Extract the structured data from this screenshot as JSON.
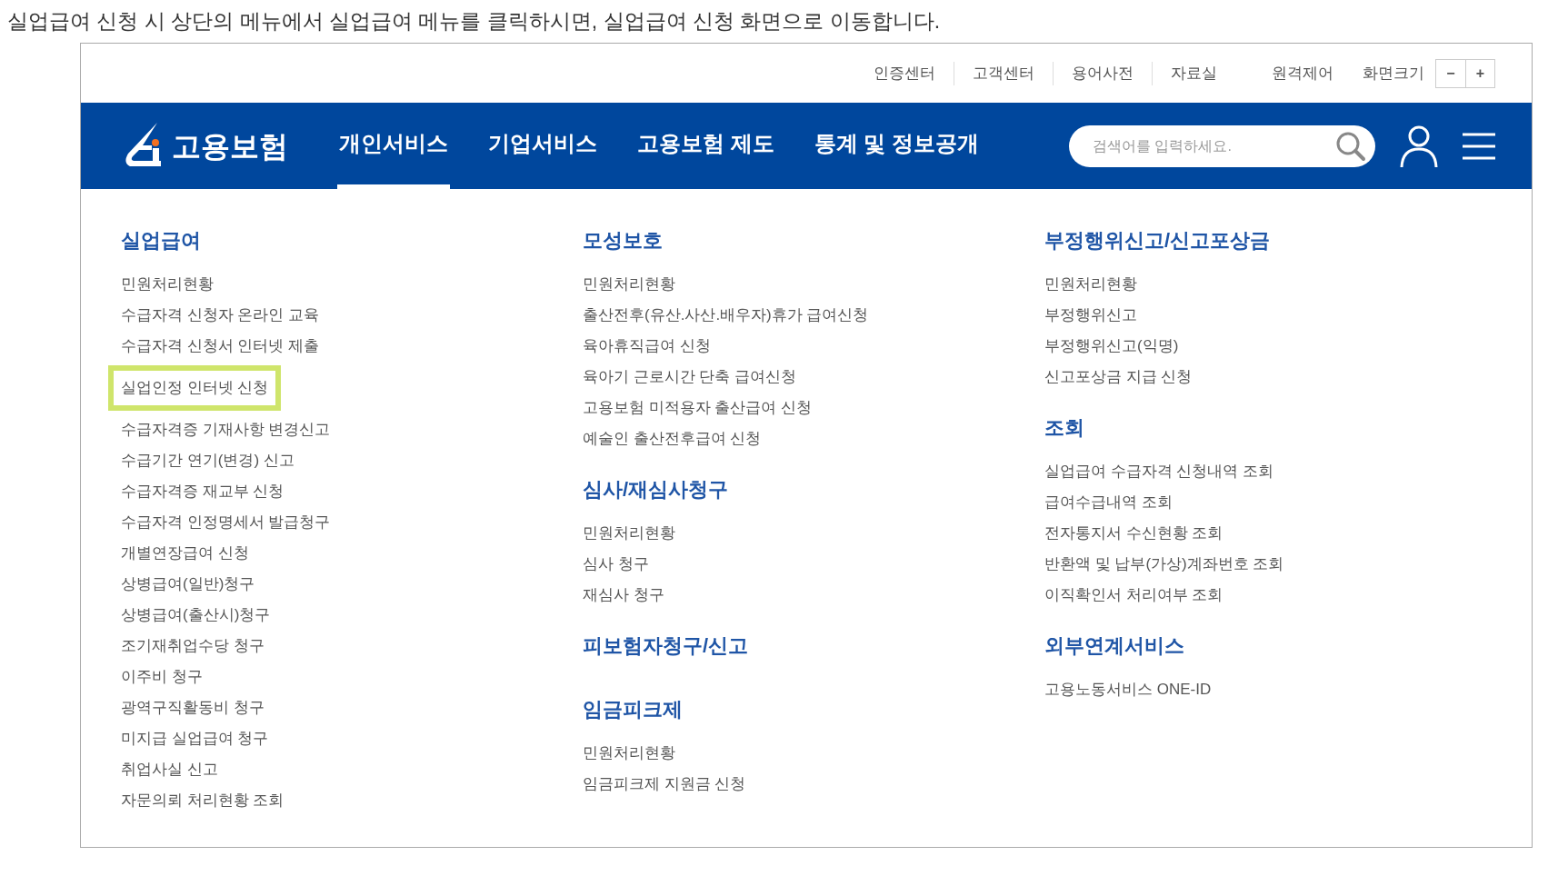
{
  "caption": "실업급여 신청 시 상단의 메뉴에서 실업급여 메뉴를 클릭하시면, 실업급여 신청 화면으로 이동합니다.",
  "utility_links": [
    "인증센터",
    "고객센터",
    "용어사전",
    "자료실",
    "원격제어"
  ],
  "font_size": {
    "label": "화면크기",
    "buttons": [
      "−",
      "+"
    ]
  },
  "logo": {
    "text": "고용보험"
  },
  "nav": [
    {
      "label": "개인서비스",
      "selected": true
    },
    {
      "label": "기업서비스",
      "selected": false
    },
    {
      "label": "고용보험 제도",
      "selected": false
    },
    {
      "label": "통계 및 정보공개",
      "selected": false
    }
  ],
  "search": {
    "placeholder": "검색어를 입력하세요."
  },
  "menu_columns": [
    {
      "sections": [
        {
          "title": "실업급여",
          "items": [
            {
              "label": "민원처리현황",
              "highlighted": false
            },
            {
              "label": "수급자격 신청자 온라인 교육",
              "highlighted": false
            },
            {
              "label": "수급자격 신청서 인터넷 제출",
              "highlighted": false
            },
            {
              "label": "실업인정 인터넷 신청",
              "highlighted": true
            },
            {
              "label": "수급자격증 기재사항 변경신고",
              "highlighted": false
            },
            {
              "label": "수급기간 연기(변경) 신고",
              "highlighted": false
            },
            {
              "label": "수급자격증 재교부 신청",
              "highlighted": false
            },
            {
              "label": "수급자격 인정명세서 발급청구",
              "highlighted": false
            },
            {
              "label": "개별연장급여 신청",
              "highlighted": false
            },
            {
              "label": "상병급여(일반)청구",
              "highlighted": false
            },
            {
              "label": "상병급여(출산시)청구",
              "highlighted": false
            },
            {
              "label": "조기재취업수당 청구",
              "highlighted": false
            },
            {
              "label": "이주비 청구",
              "highlighted": false
            },
            {
              "label": "광역구직활동비 청구",
              "highlighted": false
            },
            {
              "label": "미지급 실업급여 청구",
              "highlighted": false
            },
            {
              "label": "취업사실 신고",
              "highlighted": false
            },
            {
              "label": "자문의뢰 처리현황 조회",
              "highlighted": false
            }
          ]
        }
      ]
    },
    {
      "sections": [
        {
          "title": "모성보호",
          "items": [
            {
              "label": "민원처리현황",
              "highlighted": false
            },
            {
              "label": "출산전후(유산.사산.배우자)휴가 급여신청",
              "highlighted": false
            },
            {
              "label": "육아휴직급여 신청",
              "highlighted": false
            },
            {
              "label": "육아기 근로시간 단축 급여신청",
              "highlighted": false
            },
            {
              "label": "고용보험 미적용자 출산급여 신청",
              "highlighted": false
            },
            {
              "label": "예술인 출산전후급여 신청",
              "highlighted": false
            }
          ]
        },
        {
          "title": "심사/재심사청구",
          "items": [
            {
              "label": "민원처리현황",
              "highlighted": false
            },
            {
              "label": "심사 청구",
              "highlighted": false
            },
            {
              "label": "재심사 청구",
              "highlighted": false
            }
          ]
        },
        {
          "title": "피보험자청구/신고"
        },
        {
          "title": "임금피크제",
          "items": [
            {
              "label": "민원처리현황",
              "highlighted": false
            },
            {
              "label": "임금피크제 지원금 신청",
              "highlighted": false
            }
          ]
        }
      ]
    },
    {
      "sections": [
        {
          "title": "부정행위신고/신고포상금",
          "items": [
            {
              "label": "민원처리현황",
              "highlighted": false
            },
            {
              "label": "부정행위신고",
              "highlighted": false
            },
            {
              "label": "부정행위신고(익명)",
              "highlighted": false
            },
            {
              "label": "신고포상금 지급 신청",
              "highlighted": false
            }
          ]
        },
        {
          "title": "조회",
          "items": [
            {
              "label": "실업급여 수급자격 신청내역 조회",
              "highlighted": false
            },
            {
              "label": "급여수급내역 조회",
              "highlighted": false
            },
            {
              "label": "전자통지서 수신현황 조회",
              "highlighted": false
            },
            {
              "label": "반환액 및 납부(가상)계좌번호 조회",
              "highlighted": false
            },
            {
              "label": "이직확인서 처리여부 조회",
              "highlighted": false
            }
          ]
        },
        {
          "title": "외부연계서비스",
          "items": [
            {
              "label": "고용노동서비스 ONE-ID",
              "highlighted": false
            }
          ]
        }
      ]
    }
  ]
}
